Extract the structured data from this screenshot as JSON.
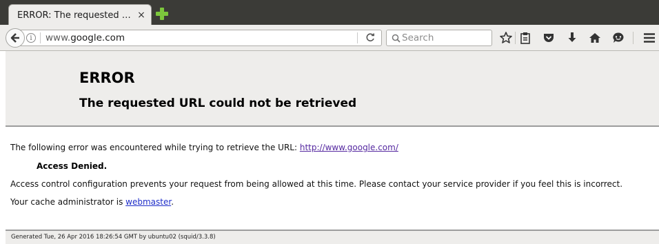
{
  "tab": {
    "title": "ERROR: The requested …",
    "close": "×"
  },
  "navbar": {
    "url_prefix": "www.",
    "url_domain": "google.com",
    "search_placeholder": "Search"
  },
  "page": {
    "title": "ERROR",
    "subtitle": "The requested URL could not be retrieved",
    "intro": "The following error was encountered while trying to retrieve the URL: ",
    "intro_link": "http://www.google.com/",
    "error_name": "Access Denied.",
    "explanation": "Access control configuration prevents your request from being allowed at this time. Please contact your service provider if you feel this is incorrect.",
    "admin_prefix": "Your cache administrator is ",
    "admin_link": "webmaster",
    "admin_suffix": ".",
    "footer": "Generated Tue, 26 Apr 2016 18:26:54 GMT by ubuntu02 (squid/3.3.8)"
  },
  "icons": [
    "back-arrow-icon",
    "info-icon",
    "reload-icon",
    "search-icon",
    "bookmark-star-icon",
    "reading-list-icon",
    "pocket-icon",
    "downloads-icon",
    "home-icon",
    "chat-icon",
    "hamburger-menu-icon"
  ],
  "colors": {
    "new_tab_plus": "#7cc73c",
    "visited_link": "#5528a0",
    "link": "#1f2ec9"
  }
}
